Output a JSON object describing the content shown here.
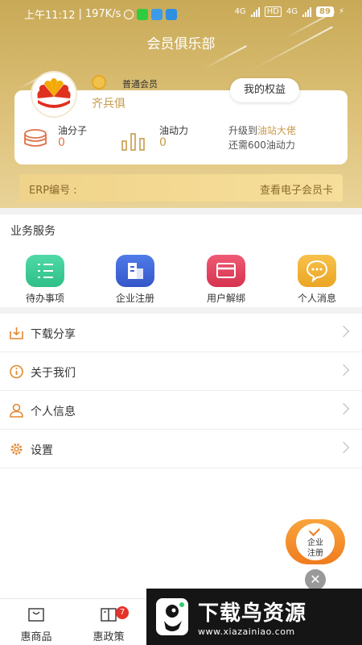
{
  "status_bar": {
    "time": "上午11:12",
    "speed": "197K/s",
    "net1": "4G",
    "hd": "HD",
    "net2": "4G",
    "battery": "89"
  },
  "header": {
    "title": "会员俱乐部"
  },
  "profile": {
    "level": "普通会员",
    "username": "齐兵俱",
    "benefits_button": "我的权益",
    "stats": [
      {
        "label": "油分子",
        "value": "0"
      },
      {
        "label": "油动力",
        "value": "0"
      }
    ],
    "upgrade_prefix": "升级到",
    "upgrade_target": "油站大佬",
    "upgrade_need": "还需600油动力"
  },
  "erp": {
    "label": "ERP编号 :",
    "link": "查看电子会员卡"
  },
  "business": {
    "title": "业务服务",
    "items": [
      {
        "label": "待办事项",
        "icon": "todo-list-icon",
        "color": "#3fcf9a"
      },
      {
        "label": "企业注册",
        "icon": "building-icon",
        "color": "#3f63d6"
      },
      {
        "label": "用户解绑",
        "icon": "card-icon",
        "color": "#e0415e"
      },
      {
        "label": "个人消息",
        "icon": "chat-bubble-icon",
        "color": "#f2b13a"
      }
    ]
  },
  "menu": [
    {
      "label": "下载分享",
      "icon": "download-icon"
    },
    {
      "label": "关于我们",
      "icon": "info-icon"
    },
    {
      "label": "个人信息",
      "icon": "person-icon"
    },
    {
      "label": "设置",
      "icon": "gear-icon"
    }
  ],
  "float_button": {
    "label_line1": "企业",
    "label_line2": "注册"
  },
  "tabbar": {
    "items": [
      {
        "label": "惠商品",
        "icon": "bag-icon"
      },
      {
        "label": "惠政策",
        "icon": "book-icon",
        "badge": "7"
      }
    ]
  },
  "watermark": {
    "title": "下载鸟资源",
    "url": "www.xiazainiao.com"
  },
  "colors": {
    "header": "#c8a957",
    "accent": "#c79a4a",
    "orange": "#f07c1e"
  }
}
